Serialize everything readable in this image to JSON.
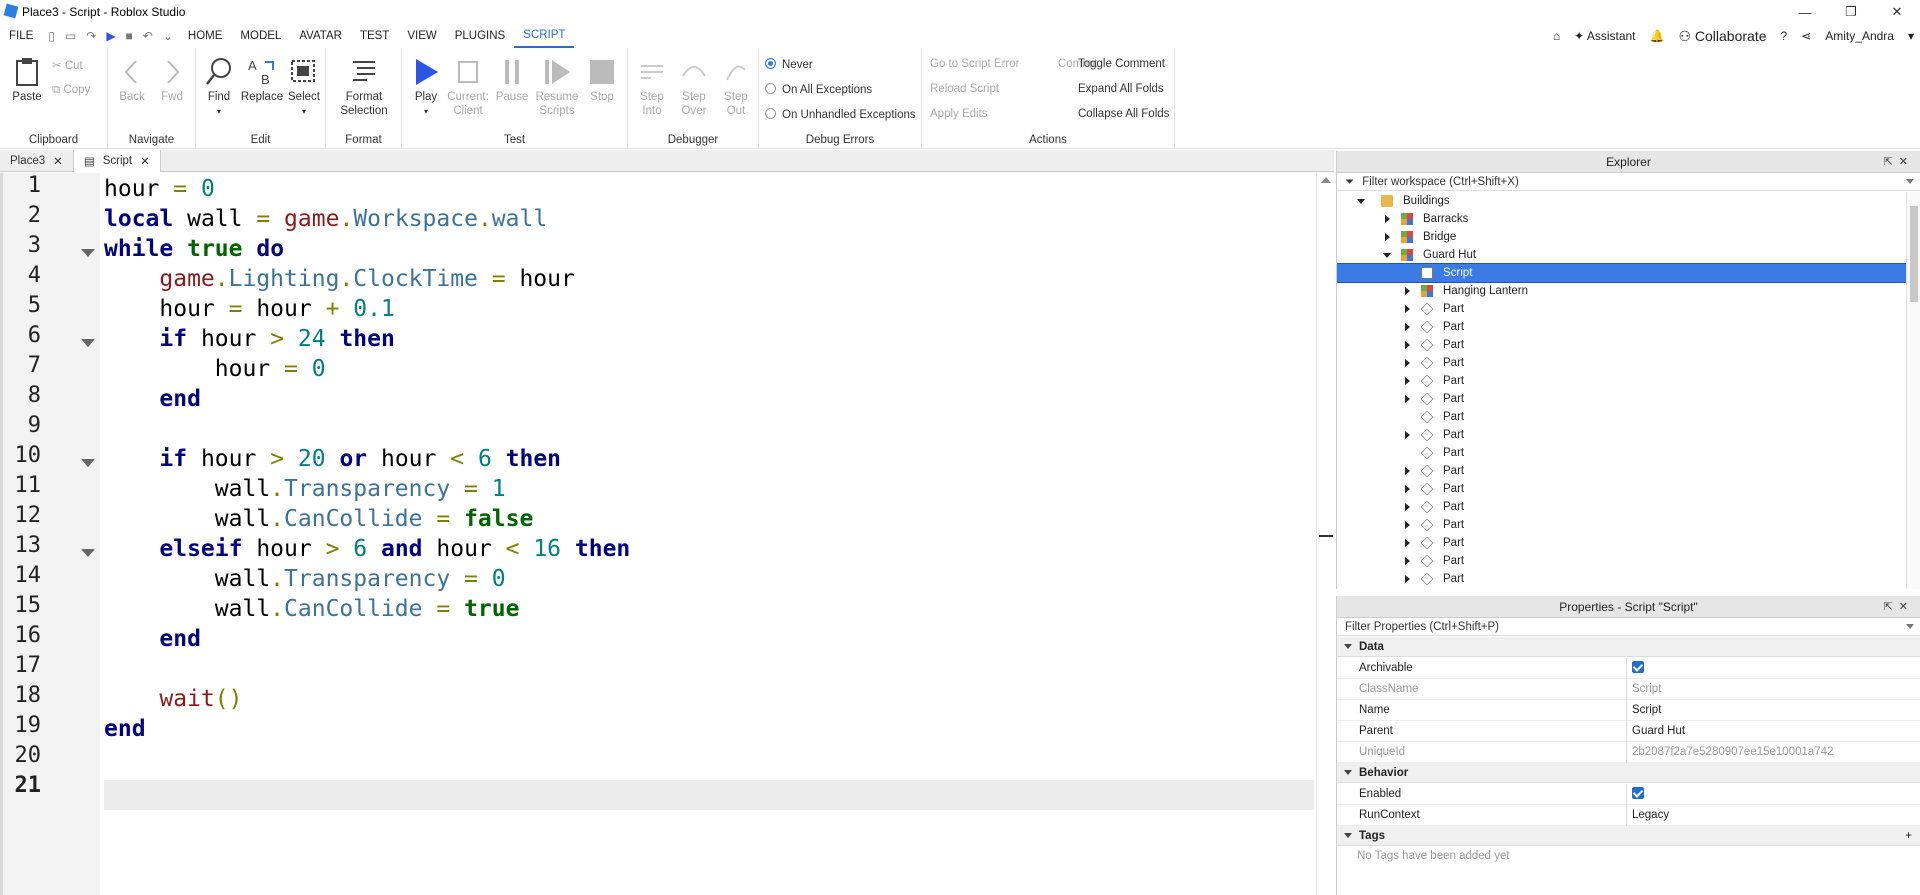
{
  "window": {
    "title": "Place3 - Script - Roblox Studio",
    "min": "—",
    "restore": "❐",
    "close": "✕"
  },
  "menu": {
    "file": "FILE",
    "tabs": [
      "HOME",
      "MODEL",
      "AVATAR",
      "TEST",
      "VIEW",
      "PLUGINS",
      "SCRIPT"
    ],
    "active_tab": "SCRIPT",
    "assistant": "Assistant",
    "collaborate": "Collaborate",
    "user": "Amity_Andra"
  },
  "ribbon": {
    "clipboard": {
      "label": "Clipboard",
      "paste": "Paste",
      "cut": "Cut",
      "copy": "Copy"
    },
    "navigate": {
      "label": "Navigate",
      "back": "Back",
      "fwd": "Fwd"
    },
    "edit": {
      "label": "Edit",
      "find": "Find",
      "replace": "Replace",
      "select": "Select"
    },
    "format": {
      "label": "Format",
      "format_selection_1": "Format",
      "format_selection_2": "Selection"
    },
    "test": {
      "label": "Test",
      "play": "Play",
      "current_client_1": "Current:",
      "current_client_2": "Client",
      "pause": "Pause",
      "resume_1": "Resume",
      "resume_2": "Scripts",
      "stop": "Stop"
    },
    "debugger": {
      "label": "Debugger",
      "step_into_1": "Step",
      "step_into_2": "Into",
      "step_over_1": "Step",
      "step_over_2": "Over",
      "step_out_1": "Step",
      "step_out_2": "Out"
    },
    "debug_errors": {
      "label": "Debug Errors",
      "never": "Never",
      "all": "On All Exceptions",
      "unhandled": "On Unhandled Exceptions",
      "selected": "Never"
    },
    "actions": {
      "label": "Actions",
      "goto_error": "Go to Script Error",
      "commit": "Commit",
      "reload": "Reload Script",
      "apply": "Apply Edits",
      "toggle_comment": "Toggle Comment",
      "expand": "Expand All Folds",
      "collapse": "Collapse All Folds"
    }
  },
  "doc_tabs": [
    {
      "label": "Place3"
    },
    {
      "label": "Script"
    }
  ],
  "editor": {
    "line_numbers": [
      "1",
      "2",
      "3",
      "4",
      "5",
      "6",
      "7",
      "8",
      "9",
      "10",
      "11",
      "12",
      "13",
      "14",
      "15",
      "16",
      "17",
      "18",
      "19",
      "20",
      "21"
    ],
    "current_line": "21"
  },
  "explorer": {
    "title": "Explorer",
    "filter": "Filter workspace (Ctrl+Shift+X)",
    "items": [
      {
        "label": "Buildings",
        "icon": "folder-icon"
      },
      {
        "label": "Barracks",
        "icon": "model-icon"
      },
      {
        "label": "Bridge",
        "icon": "model-icon"
      },
      {
        "label": "Guard Hut",
        "icon": "model-icon"
      },
      {
        "label": "Script",
        "icon": "script-icon"
      },
      {
        "label": "Hanging Lantern",
        "icon": "model-icon"
      },
      {
        "label": "Part",
        "icon": "part-icon"
      },
      {
        "label": "Part",
        "icon": "part-icon"
      },
      {
        "label": "Part",
        "icon": "part-icon"
      },
      {
        "label": "Part",
        "icon": "part-icon"
      },
      {
        "label": "Part",
        "icon": "part-icon"
      },
      {
        "label": "Part",
        "icon": "part-icon"
      },
      {
        "label": "Part",
        "icon": "part-icon"
      },
      {
        "label": "Part",
        "icon": "part-icon"
      },
      {
        "label": "Part",
        "icon": "part-icon"
      },
      {
        "label": "Part",
        "icon": "part-icon"
      },
      {
        "label": "Part",
        "icon": "part-icon"
      },
      {
        "label": "Part",
        "icon": "part-icon"
      },
      {
        "label": "Part",
        "icon": "part-icon"
      },
      {
        "label": "Part",
        "icon": "part-icon"
      },
      {
        "label": "Part",
        "icon": "part-icon"
      },
      {
        "label": "Part",
        "icon": "part-icon"
      }
    ]
  },
  "properties": {
    "title": "Properties - Script \"Script\"",
    "filter": "Filter Properties (Ctrl+Shift+P)",
    "cat_data": "Data",
    "archivable": {
      "name": "Archivable",
      "value": true
    },
    "classname": {
      "name": "ClassName",
      "value": "Script"
    },
    "name": {
      "name": "Name",
      "value": "Script"
    },
    "parent": {
      "name": "Parent",
      "value": "Guard Hut"
    },
    "uniqueid": {
      "name": "UniqueId",
      "value": "2b2087f2a7e5280907ee15e10001a742"
    },
    "cat_behavior": "Behavior",
    "enabled": {
      "name": "Enabled",
      "value": true
    },
    "runcontext": {
      "name": "RunContext",
      "value": "Legacy"
    },
    "cat_tags": "Tags",
    "tags_empty": "No Tags have been added yet"
  }
}
